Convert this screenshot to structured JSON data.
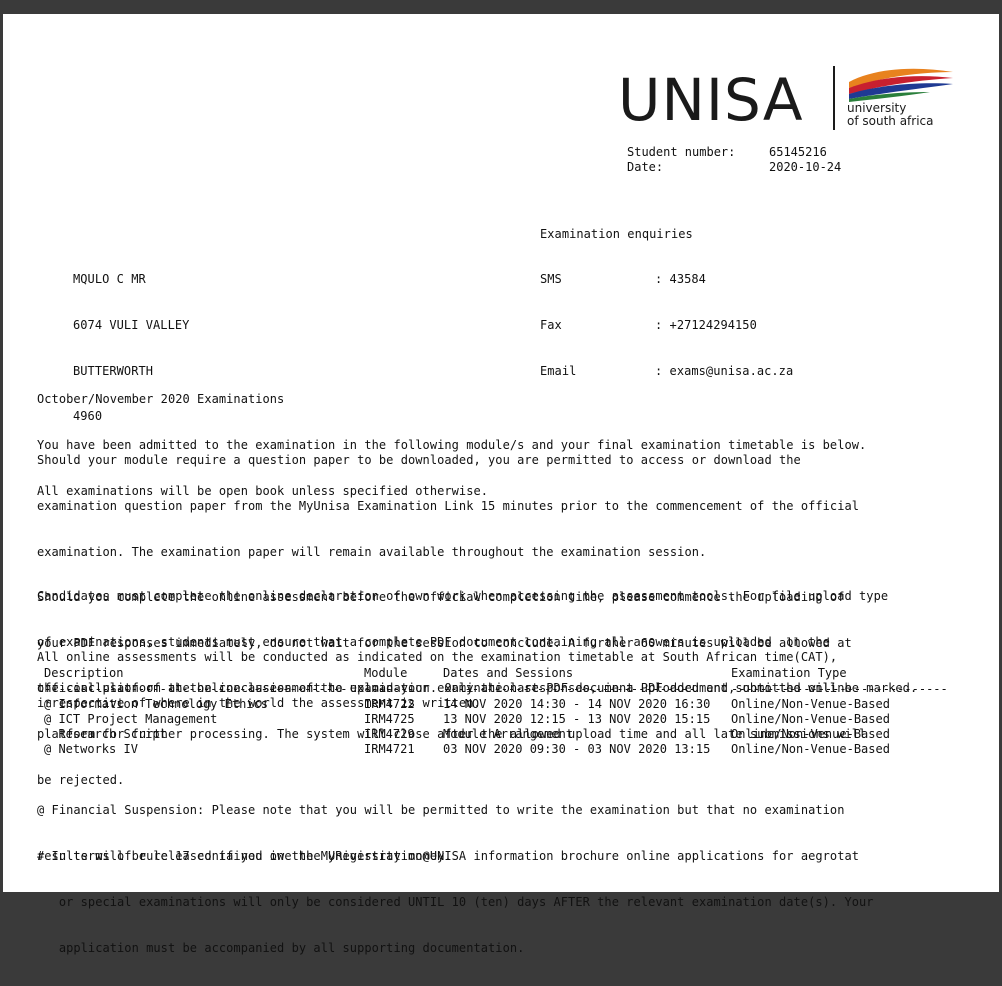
{
  "logo": {
    "word": "UNISA",
    "line1": "university",
    "line2": "of south africa",
    "colors": {
      "orange": "#e8821e",
      "red": "#c8202f",
      "blue": "#1f3a93",
      "green": "#2a7f3b"
    }
  },
  "student": {
    "number_label": "Student number:",
    "number_value": "65145216",
    "date_label": "Date:",
    "date_value": "2020-10-24"
  },
  "address": {
    "lines": [
      "MQULO C MR",
      "6074 VULI VALLEY",
      "BUTTERWORTH",
      "4960"
    ]
  },
  "enquiries": {
    "title": "Examination enquiries",
    "rows": [
      {
        "label": "SMS",
        "value": ": 43584"
      },
      {
        "label": "Fax",
        "value": ": +27124294150"
      },
      {
        "label": "Email",
        "value": ": exams@unisa.ac.za"
      }
    ]
  },
  "body": {
    "p1": [
      "October/November 2020 Examinations",
      "You have been admitted to the examination in the following module/s and your final examination timetable is below.",
      "All examinations will be open book unless specified otherwise."
    ],
    "p2": [
      "Should your module require a question paper to be downloaded, you are permitted to access or download the",
      "examination question paper from the MyUnisa Examination Link 15 minutes prior to the commencement of the official",
      "examination. The examination paper will remain available throughout the examination session.",
      "Should you complete the online assessment before the official completion time, please commence the uploading of",
      "your PDF responses immediately, do not wait for the session to conclude. A further 60 minutes will be allowed at",
      "the conclusion of the online assessment to upload your examination responses, in a PDF document, onto the online",
      "platform for further processing. The system will close after the allowed upload time and all late submissions will",
      "be rejected."
    ],
    "p3": [
      "Candidates must complete the online declaration of own work when accessing the assessment tools. For file upload type",
      "of examinations, students must ensure that a complete PDF document containing all answers is uploaded  on the",
      "official platform at the conclusion of the examination. Only the last PDF document uploaded and submitted will be marked."
    ],
    "p4": [
      "All online assessments will be conducted as indicated on the examination timetable at South African time(CAT),",
      "irrespective of where in the world the assessment is written."
    ]
  },
  "table": {
    "headers": {
      "desc": "Description",
      "mod": "Module",
      "date": "Dates and Sessions",
      "type": "Examination Type"
    },
    "rules": {
      "desc": "------------------------------------------",
      "mod": "-------",
      "date": "-----------------------------------",
      "type": "------------------------------"
    },
    "rows": [
      {
        "desc": "@ Information Technology Ethics",
        "mod": "IRM4722",
        "date": "14 NOV 2020 14:30 - 14 NOV 2020 16:30",
        "type": "Online/Non-Venue-Based"
      },
      {
        "desc": "@ ICT Project Management",
        "mod": "IRM4725",
        "date": "13 NOV 2020 12:15 - 13 NOV 2020 15:15",
        "type": "Online/Non-Venue-Based"
      },
      {
        "desc": "  Research Script",
        "mod": "IRM4729",
        "date": "Module Arrangement",
        "type": "Online/Non-Venue-Based"
      },
      {
        "desc": "@ Networks IV",
        "mod": "IRM4721",
        "date": "03 NOV 2020 09:30 - 03 NOV 2020 13:15",
        "type": "Online/Non-Venue-Based"
      }
    ]
  },
  "notes": {
    "financial": [
      "@ Financial Suspension: Please note that you will be permitted to write the examination but that no examination",
      "results will be released if you owe the University money."
    ],
    "rule17": [
      "# In terms of rule 17 contained in the MyRegistration@UNISA information brochure online applications for aegrotat",
      "   or special examinations will only be considered UNTIL 10 (ten) days AFTER the relevant examination date(s). Your",
      "   application must be accompanied by all supporting documentation."
    ]
  }
}
